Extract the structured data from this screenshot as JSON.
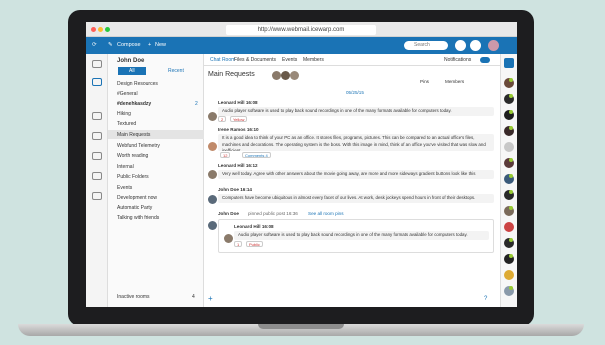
{
  "browser": {
    "url": "http://www.webmail.icewarp.com"
  },
  "topbar": {
    "compose": "Compose",
    "new": "New",
    "search_placeholder": "Search"
  },
  "sidebar": {
    "user": "John Doe",
    "tab_all": "All",
    "tab_recent": "Recent",
    "items": [
      "Design Resources",
      "#General",
      "#denehkasdzy",
      "Hiking",
      "Textured",
      "Main Requests",
      "Webfund Telemetry",
      "Worth reading",
      "Internal",
      "Public Folders",
      "Events",
      "Development now",
      "Automatic Party",
      "Talking with friends"
    ],
    "badge": "2",
    "footer": "Inactive rooms",
    "footer_count": "4"
  },
  "main": {
    "tabs": [
      "Chat Room",
      "Files & Documents",
      "Events",
      "Members"
    ],
    "notifications": "Notifications",
    "title": "Main Requests",
    "pins": "Pins",
    "members": "Members",
    "date": "05/25/15",
    "messages": [
      {
        "author": "Leonard Hill 16:08",
        "text": "Audio player software is used to play back sound recordings in one of the many formats available for computers today."
      },
      {
        "author": "Irene Ramos 16:10",
        "text": "It is a good idea to think of your PC as an office. It stores files, programs, pictures. This can be compared to an actual office's files, machines and decorations. The operating system is the boss. With this image in mind, think of an office you've visited that was slow and inefficient."
      },
      {
        "author": "Leonard Hill 16:12",
        "text": "Very well today. Agree with other answers about the movie going away, are more and more sideways gradient buttons look like this"
      },
      {
        "author": "John Doe 16:14",
        "text": "Computers have become ubiquitous in almost every facet of our lives. At work, desk jockeys spend hours in front of their desktops."
      },
      {
        "author": "Leonard Hill 16:08",
        "text": "Audio player software is used to play back sound recordings in one of the many formats available for computers today."
      }
    ],
    "pinned_author": "John Doe",
    "pinned_text": "pinned public post 16:36",
    "pinned_link": "See all room pins",
    "react1_count": "2",
    "react1_label": "Yellow",
    "react2_count": "12",
    "comments": "Comments 4",
    "react3_count": "1",
    "react3_label": "Public"
  }
}
